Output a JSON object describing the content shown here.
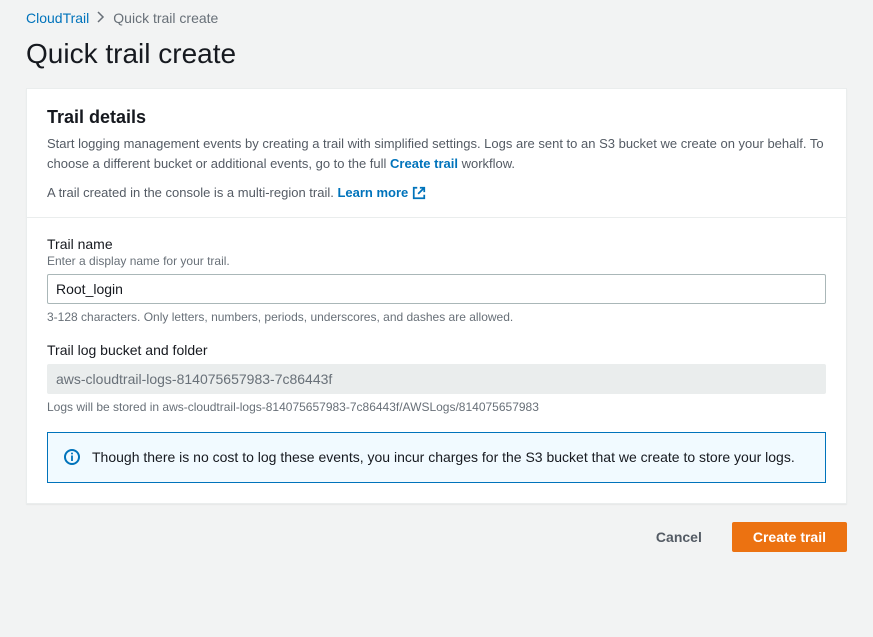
{
  "breadcrumb": {
    "root": "CloudTrail",
    "current": "Quick trail create"
  },
  "page_title": "Quick trail create",
  "panel": {
    "title": "Trail details",
    "desc_part1": "Start logging management events by creating a trail with simplified settings. Logs are sent to an S3 bucket we create on your behalf. To choose a different bucket or additional events, go to the full ",
    "create_trail_link": "Create trail",
    "desc_part2": " workflow.",
    "multi_region_text": "A trail created in the console is a multi-region trail. ",
    "learn_more": "Learn more"
  },
  "trail_name": {
    "label": "Trail name",
    "hint": "Enter a display name for your trail.",
    "value": "Root_login",
    "help": "3-128 characters. Only letters, numbers, periods, underscores, and dashes are allowed."
  },
  "trail_bucket": {
    "label": "Trail log bucket and folder",
    "value": "aws-cloudtrail-logs-814075657983-7c86443f",
    "help": "Logs will be stored in aws-cloudtrail-logs-814075657983-7c86443f/AWSLogs/814075657983"
  },
  "info": {
    "text": "Though there is no cost to log these events, you incur charges for the S3 bucket that we create to store your logs."
  },
  "actions": {
    "cancel": "Cancel",
    "create": "Create trail"
  }
}
